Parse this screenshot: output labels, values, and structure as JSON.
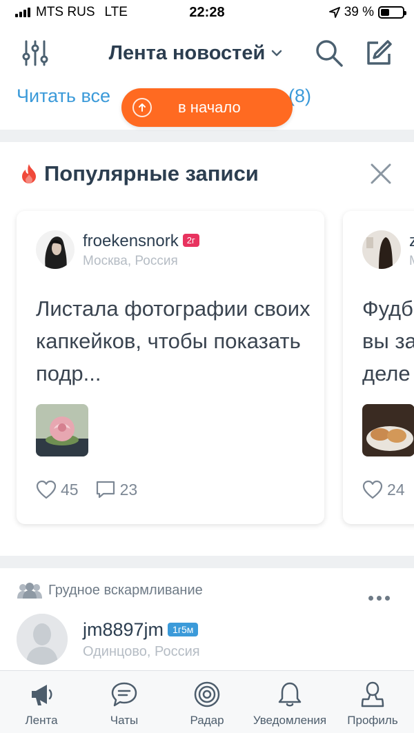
{
  "status_bar": {
    "carrier": "MTS RUS",
    "network": "LTE",
    "time": "22:28",
    "battery": "39 %",
    "battery_level": 0.39
  },
  "header": {
    "title": "Лента новостей",
    "icons": [
      "filter-sliders-icon",
      "chevron-down-icon",
      "search-icon",
      "compose-icon"
    ]
  },
  "read_all": {
    "label": "Читать все",
    "count": "(8)"
  },
  "to_top": {
    "label": "в начало"
  },
  "popular": {
    "title": "Популярные записи",
    "cards": [
      {
        "author": "froekensnork",
        "age": "2г",
        "location": "Москва, Россия",
        "text": "Листала фотографии своих капкейков, чтобы показать подр...",
        "likes": "45",
        "comments": "23"
      },
      {
        "author": "z",
        "location": "М",
        "text": "Фудб вы за деле",
        "likes": "24"
      }
    ]
  },
  "post": {
    "community": "Грудное вскармливание",
    "author": "jm8897jm",
    "age": "1г5м",
    "location": "Одинцово, Россия"
  },
  "tabs": [
    {
      "label": "Лента",
      "icon": "megaphone-icon"
    },
    {
      "label": "Чаты",
      "icon": "chat-icon"
    },
    {
      "label": "Радар",
      "icon": "radar-icon"
    },
    {
      "label": "Уведомления",
      "icon": "bell-icon"
    },
    {
      "label": "Профиль",
      "icon": "profile-icon"
    }
  ],
  "colors": {
    "accent_orange": "#ff6a21",
    "link_blue": "#3b9ad9",
    "title_dark": "#2c3e50",
    "badge_pink": "#e8335f",
    "badge_blue": "#3b9ad9"
  }
}
